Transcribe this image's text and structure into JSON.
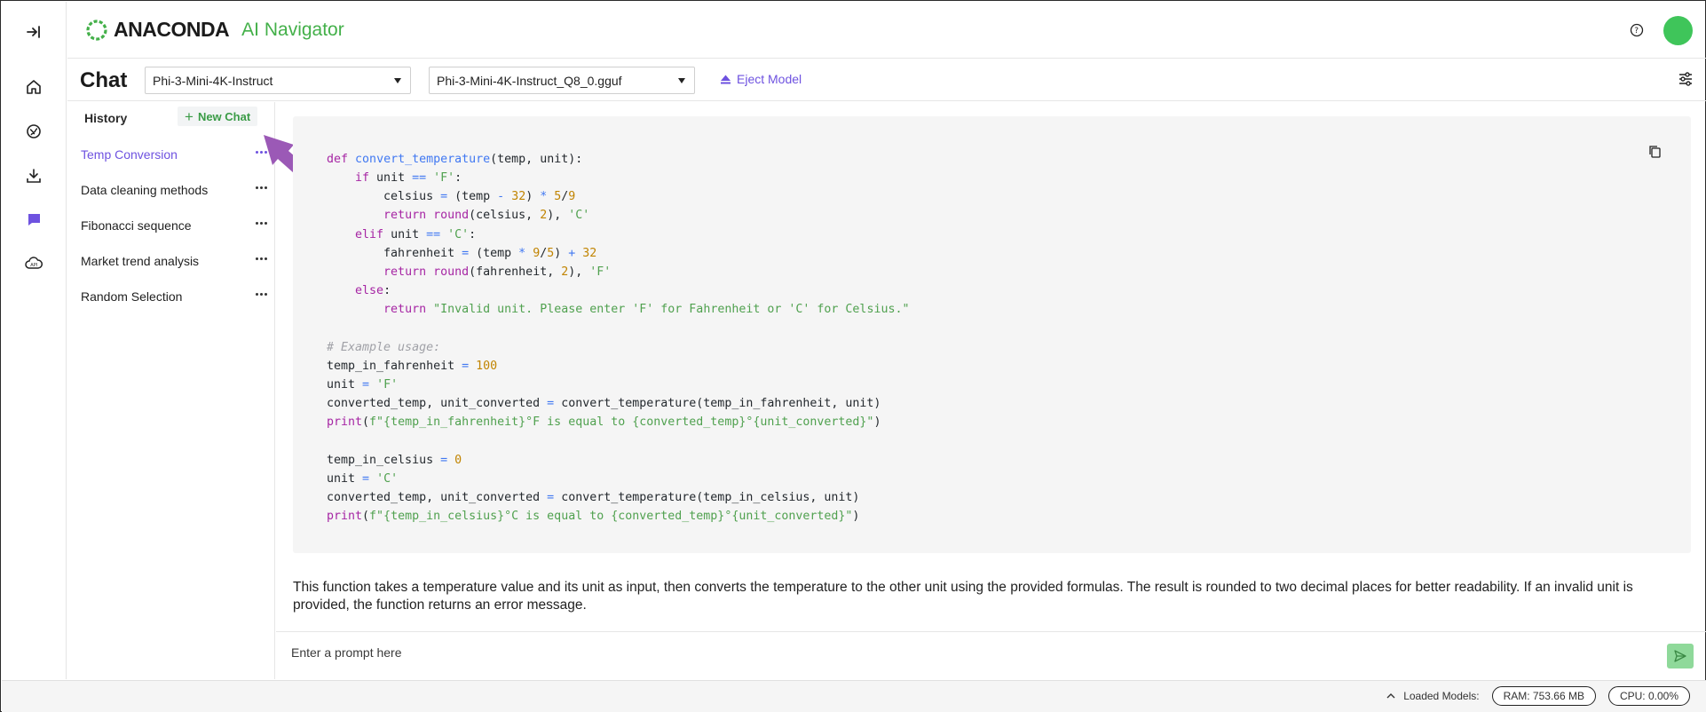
{
  "app": {
    "brand": "ANACONDA",
    "brand_mark": ".",
    "product": "AI Navigator"
  },
  "colors": {
    "accent_purple": "#6e52e0",
    "brand_green": "#43b049",
    "avatar_green": "#3fc55a",
    "send_green": "#8fd99a",
    "annotation_arrow": "#9b59b6"
  },
  "rail": {
    "items": [
      {
        "icon": "collapse-sidebar-icon"
      },
      {
        "icon": "home-icon"
      },
      {
        "icon": "models-icon"
      },
      {
        "icon": "download-icon"
      },
      {
        "icon": "chat-icon",
        "active": true
      },
      {
        "icon": "api-server-icon"
      }
    ]
  },
  "header": {
    "page_title": "Chat",
    "model_select": "Phi-3-Mini-4K-Instruct",
    "file_select": "Phi-3-Mini-4K-Instruct_Q8_0.gguf",
    "eject_label": "Eject Model"
  },
  "history": {
    "title": "History",
    "new_chat_label": "New Chat",
    "items": [
      {
        "label": "Temp Conversion",
        "active": true
      },
      {
        "label": "Data cleaning methods"
      },
      {
        "label": "Fibonacci sequence"
      },
      {
        "label": "Market trend analysis"
      },
      {
        "label": "Random Selection"
      }
    ]
  },
  "message": {
    "code_language": "python",
    "code_lines": [
      "def convert_temperature(temp, unit):",
      "    if unit == 'F':",
      "        celsius = (temp - 32) * 5/9",
      "        return round(celsius, 2), 'C'",
      "    elif unit == 'C':",
      "        fahrenheit = (temp * 9/5) + 32",
      "        return round(fahrenheit, 2), 'F'",
      "    else:",
      "        return \"Invalid unit. Please enter 'F' for Fahrenheit or 'C' for Celsius.\"",
      "",
      "# Example usage:",
      "temp_in_fahrenheit = 100",
      "unit = 'F'",
      "converted_temp, unit_converted = convert_temperature(temp_in_fahrenheit, unit)",
      "print(f\"{temp_in_fahrenheit}°F is equal to {converted_temp}°{unit_converted}\")",
      "",
      "temp_in_celsius = 0",
      "unit = 'C'",
      "converted_temp, unit_converted = convert_temperature(temp_in_celsius, unit)",
      "print(f\"{temp_in_celsius}°C is equal to {converted_temp}°{unit_converted}\")"
    ],
    "explanation": "This function takes a temperature value and its unit as input, then converts the temperature to the other unit using the provided formulas. The result is rounded to two decimal places for better readability. If an invalid unit is provided, the function returns an error message."
  },
  "prompt": {
    "placeholder": "Enter a prompt here"
  },
  "status": {
    "loaded_models_label": "Loaded Models:",
    "ram": "RAM: 753.66 MB",
    "cpu": "CPU: 0.00%"
  }
}
